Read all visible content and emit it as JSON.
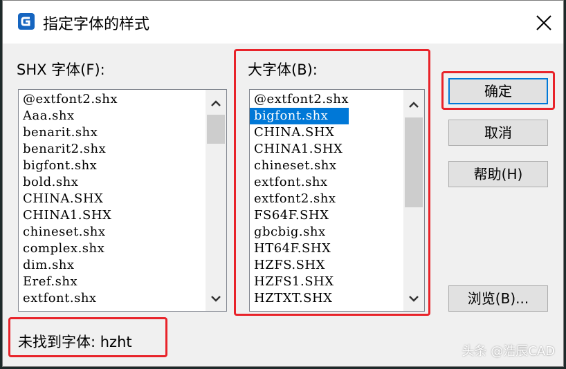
{
  "window": {
    "title": "指定字体的样式"
  },
  "shx_font": {
    "label": "SHX 字体(F):",
    "items": [
      "@extfont2.shx",
      "Aaa.shx",
      "benarit.shx",
      "benarit2.shx",
      "bigfont.shx",
      "bold.shx",
      "CHINA.SHX",
      "CHINA1.SHX",
      "chineset.shx",
      "complex.shx",
      "dim.shx",
      "Eref.shx",
      "extfont.shx"
    ]
  },
  "big_font": {
    "label": "大字体(B):",
    "selected": "bigfont.shx",
    "items": [
      "@extfont2.shx",
      "bigfont.shx",
      "CHINA.SHX",
      "CHINA1.SHX",
      "chineset.shx",
      "extfont.shx",
      "extfont2.shx",
      "FS64F.SHX",
      "gbcbig.shx",
      "HT64F.SHX",
      "HZFS.SHX",
      "HZFS1.SHX",
      "HZTXT.SHX"
    ]
  },
  "buttons": {
    "ok": "确定",
    "cancel": "取消",
    "help": "帮助(H)",
    "browse": "浏览(B)..."
  },
  "status": {
    "missing_font": "未找到字体: hzht"
  },
  "watermark": "头条 @浩辰CAD",
  "colors": {
    "highlight": "#e8232a",
    "selection": "#0078d7"
  }
}
